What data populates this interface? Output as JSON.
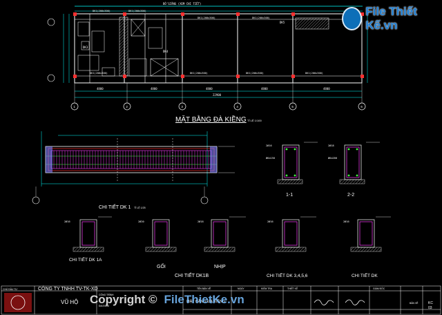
{
  "plan": {
    "title": "MẶT BẰNG ĐÀ KIỀNG",
    "scale": "TỈ LỆ 1/100",
    "annotation": "BỔ GIẰNG (XEM CHI TIẾT)",
    "beam_labels": [
      "DK1(200x300)",
      "DK1(200x300)",
      "DK1(200x300)",
      "DK1(200x300)",
      "DK1(200x300)",
      "DK1(200x300)",
      "DK1(200x300)",
      "DK1(200x300)"
    ],
    "room_tags": [
      "DK3",
      "DK4",
      "DK5"
    ],
    "dims_bottom": [
      "4800",
      "4800",
      "4800",
      "4800",
      "4800"
    ],
    "dim_total": "22900",
    "grid_axes": [
      "1",
      "2",
      "3",
      "4",
      "5",
      "6"
    ]
  },
  "details": {
    "dk1_title": "CHI TIẾT DK 1",
    "dk1_scale": "TỈ LỆ 1/25",
    "section_1": "1-1",
    "section_2": "2-2",
    "dk1a": "CHI TIẾT DK 1A",
    "goi": "GỐI",
    "nhip": "NHỊP",
    "dk1b": "CHI TIẾT DK1B",
    "dk3456": "CHI TIẾT DK 3,4,5,6",
    "dk": "CHI TIẾT DK",
    "rebar_small": [
      "2Ø16",
      "Ø6a150",
      "Ø6a200",
      "2Ø18",
      "2Ø20"
    ]
  },
  "title_block": {
    "company": "CÔNG TY TNHH TV-TK-XD",
    "owner_label": "CHỦ ĐẦU TƯ",
    "owner_name": "VŨ HỘ",
    "project_label": "CÔNG TRÌNH",
    "location_label": "ĐỊA ĐIỂM",
    "drawing_name_label": "TÊN BẢN VẼ",
    "drawing_name": "MẶT BẰNG ĐÀ KIỀNG",
    "date_label": "NGÀY",
    "designer_label": "THIẾT KẾ",
    "checker_label": "KIỂM TRA",
    "director_label": "GIÁM ĐỐC",
    "sheet_label": "BẢN VẼ",
    "sheet_code": "KC",
    "sheet_num": "03"
  },
  "watermarks": {
    "logo_text": "File Thiết Kế.vn",
    "footer_left": "Copyright ©",
    "footer_brand": "FileThietKe.vn"
  },
  "colors": {
    "background": "#000000",
    "lines_white": "#ffffff",
    "dims_cyan": "#00ffff",
    "columns_red": "#ff3030",
    "beams_magenta": "#ff40ff",
    "rebar_green": "#40ff40",
    "hatch_grey": "#a0a0a0"
  }
}
